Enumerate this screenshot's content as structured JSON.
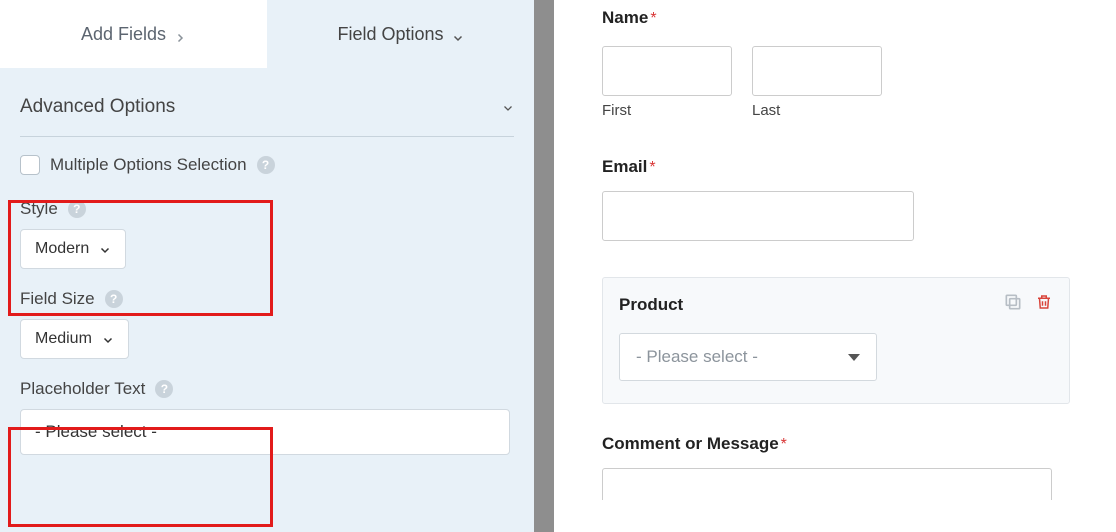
{
  "tabs": {
    "add_fields": "Add Fields",
    "field_options": "Field Options"
  },
  "section": {
    "title": "Advanced Options"
  },
  "options": {
    "multiple_selection": "Multiple Options Selection",
    "style_label": "Style",
    "style_value": "Modern",
    "field_size_label": "Field Size",
    "field_size_value": "Medium",
    "placeholder_label": "Placeholder Text",
    "placeholder_value": "- Please select -"
  },
  "form": {
    "name_label": "Name",
    "first": "First",
    "last": "Last",
    "email_label": "Email",
    "product_label": "Product",
    "product_placeholder": "- Please select -",
    "comment_label": "Comment or Message"
  }
}
